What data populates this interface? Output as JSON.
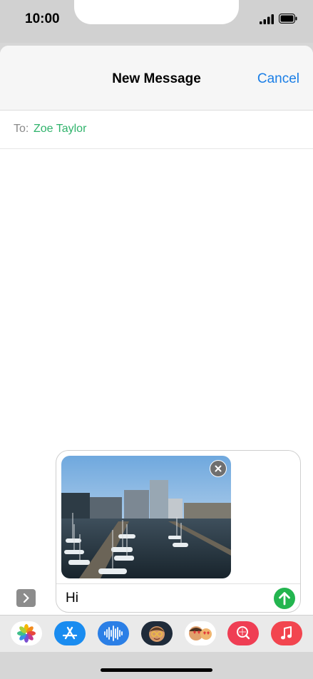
{
  "status_bar": {
    "time": "10:00"
  },
  "nav": {
    "title": "New Message",
    "cancel": "Cancel"
  },
  "recipient": {
    "label": "To:",
    "name": "Zoe Taylor"
  },
  "compose": {
    "attachment": "harbour-photo",
    "message": "Hi"
  },
  "app_drawer": [
    {
      "name": "photos-app-icon"
    },
    {
      "name": "app-store-icon"
    },
    {
      "name": "audio-message-icon"
    },
    {
      "name": "memoji-icon"
    },
    {
      "name": "memoji-stickers-icon"
    },
    {
      "name": "image-search-icon"
    },
    {
      "name": "music-icon"
    }
  ],
  "colors": {
    "accent_blue": "#1a7ee6",
    "recipient_green": "#2fb36b",
    "send_green": "#23b54f"
  }
}
